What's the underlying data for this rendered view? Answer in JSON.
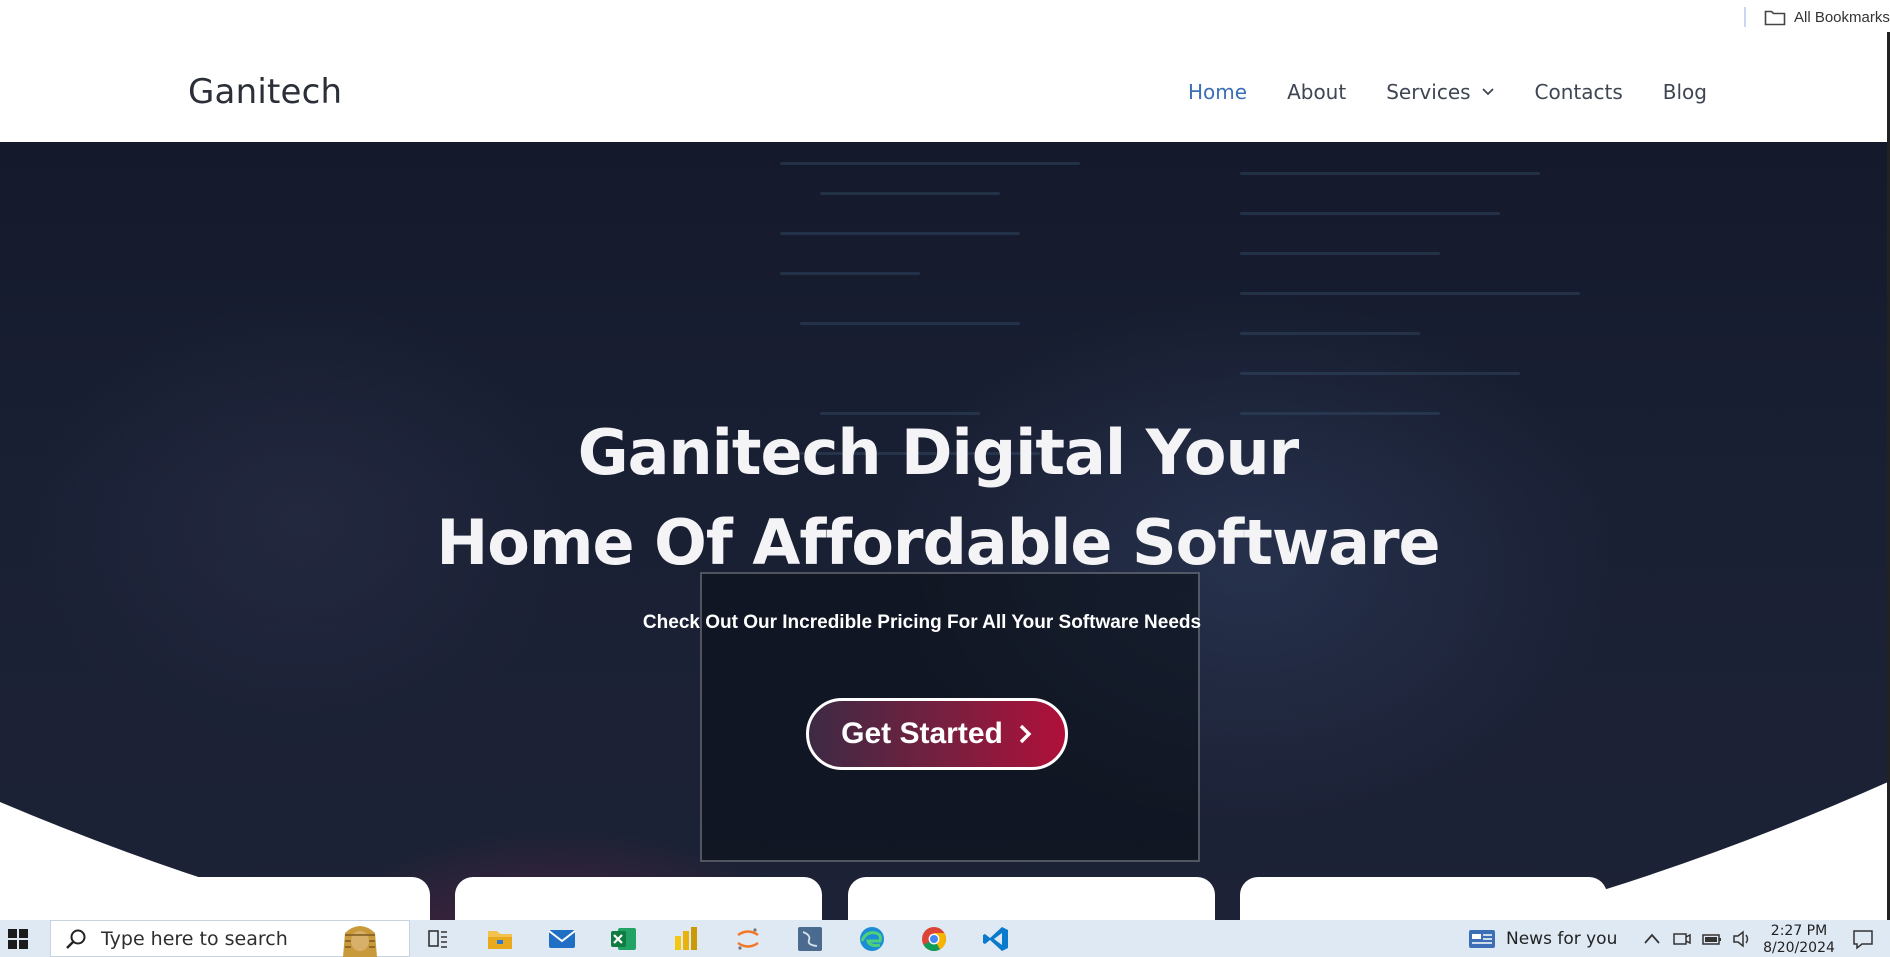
{
  "bookmarks": {
    "all_bookmarks_label": "All Bookmarks"
  },
  "header": {
    "brand": "Ganitech",
    "nav": [
      {
        "label": "Home",
        "active": true
      },
      {
        "label": "About",
        "active": false
      },
      {
        "label": "Services",
        "active": false,
        "has_dropdown": true
      },
      {
        "label": "Contacts",
        "active": false
      },
      {
        "label": "Blog",
        "active": false
      }
    ]
  },
  "hero": {
    "title_line1": "Ganitech Digital Your",
    "title_line2": "Home Of Affordable Software",
    "subtitle": "Check Out Our Incredible Pricing For All Your Software Needs",
    "cta_label": "Get Started"
  },
  "taskbar": {
    "search_placeholder": "Type here to search",
    "news_label": "News for you",
    "time": "2:27 PM",
    "date": "8/20/2024",
    "apps": [
      "task-view-icon",
      "file-explorer-icon",
      "mail-icon",
      "excel-icon",
      "power-bi-icon",
      "jupyter-icon",
      "sql-server-icon",
      "edge-icon",
      "chrome-icon",
      "vscode-icon"
    ]
  },
  "colors": {
    "nav_active": "#3b6fb6",
    "cta_gradient_start": "#3d2a44",
    "cta_gradient_end": "#b0103a",
    "hero_background": "#1a2034"
  }
}
